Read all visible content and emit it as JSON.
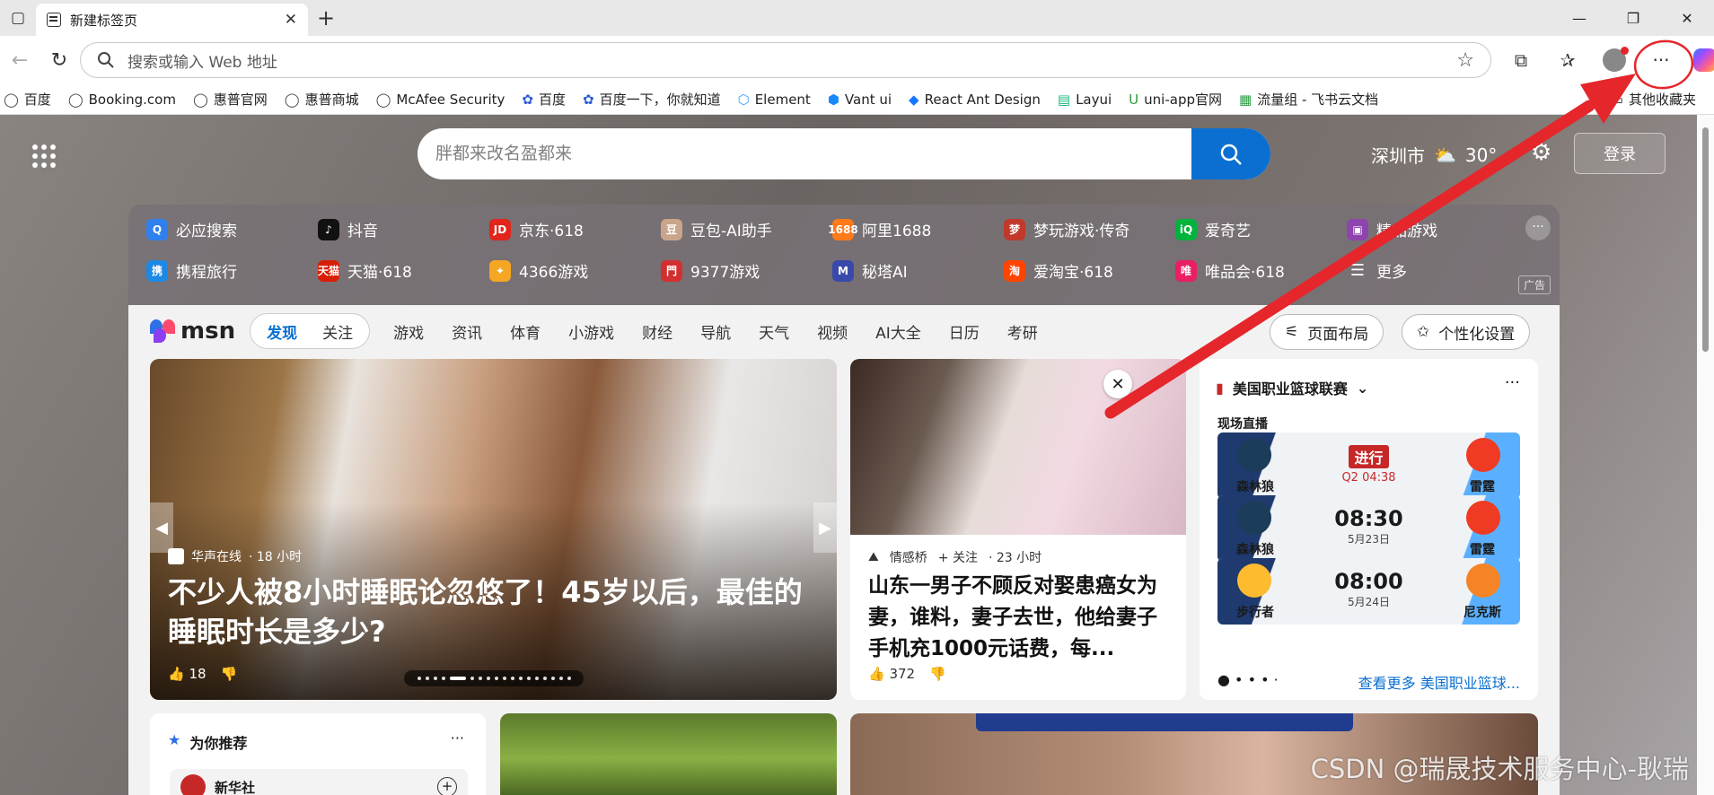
{
  "tab": {
    "title": "新建标签页",
    "close": "✕",
    "new": "+"
  },
  "window": {
    "minimize": "—",
    "restore": "❐",
    "close": "✕"
  },
  "address": {
    "placeholder": "搜索或输入 Web 地址"
  },
  "toolbar": {
    "more": "···"
  },
  "favorites": [
    {
      "label": "百度",
      "icon": "globe"
    },
    {
      "label": "Booking.com",
      "icon": "globe"
    },
    {
      "label": "惠普官网",
      "icon": "globe"
    },
    {
      "label": "惠普商城",
      "icon": "globe"
    },
    {
      "label": "McAfee Security",
      "icon": "globe"
    },
    {
      "label": "百度",
      "icon": "paw"
    },
    {
      "label": "百度一下，你就知道",
      "icon": "paw"
    },
    {
      "label": "Element",
      "icon": "element"
    },
    {
      "label": "Vant ui",
      "icon": "vant"
    },
    {
      "label": "React Ant Design",
      "icon": "ant"
    },
    {
      "label": "Layui",
      "icon": "layui"
    },
    {
      "label": "uni-app官网",
      "icon": "uniapp"
    },
    {
      "label": "流量组 - 飞书云文档",
      "icon": "feishu"
    }
  ],
  "favorites_other": "其他收藏夹",
  "newtab": {
    "search_placeholder": "胖都来改名盈都来",
    "city": "深圳市",
    "temp": "30°",
    "login": "登录"
  },
  "quicklinks": [
    {
      "label": "必应搜索",
      "color": "#2f80ed",
      "glyph": "Q"
    },
    {
      "label": "抖音",
      "color": "#111111",
      "glyph": "♪"
    },
    {
      "label": "京东·618",
      "color": "#e1251b",
      "glyph": "JD"
    },
    {
      "label": "豆包-AI助手",
      "color": "#c9a58b",
      "glyph": "豆"
    },
    {
      "label": "阿里1688",
      "color": "#ff7a1a",
      "glyph": "1688"
    },
    {
      "label": "梦玩游戏·传奇",
      "color": "#c0392b",
      "glyph": "梦"
    },
    {
      "label": "爱奇艺",
      "color": "#00b33c",
      "glyph": "iQ"
    },
    {
      "label": "精品游戏",
      "color": "#8e44ad",
      "glyph": "▣"
    },
    {
      "label": "携程旅行",
      "color": "#1e88e5",
      "glyph": "携"
    },
    {
      "label": "天猫·618",
      "color": "#d81e06",
      "glyph": "天猫"
    },
    {
      "label": "4366游戏",
      "color": "#f5a623",
      "glyph": "✦"
    },
    {
      "label": "9377游戏",
      "color": "#d32f2f",
      "glyph": "門"
    },
    {
      "label": "秘塔AI",
      "color": "#3949ab",
      "glyph": "M"
    },
    {
      "label": "爱淘宝·618",
      "color": "#ff4400",
      "glyph": "淘"
    },
    {
      "label": "唯品会·618",
      "color": "#e91e63",
      "glyph": "唯"
    },
    {
      "label": "更多",
      "color": "transparent",
      "glyph": "☰"
    }
  ],
  "quick_ad": "广告",
  "msn": {
    "logo": "msn",
    "feed_tabs": [
      "发现",
      "关注"
    ],
    "nav": [
      "游戏",
      "资讯",
      "体育",
      "小游戏",
      "财经",
      "导航",
      "天气",
      "视频",
      "AI大全",
      "日历",
      "考研"
    ],
    "layout": "页面布局",
    "personalize": "个性化设置"
  },
  "hero": {
    "source": "华声在线",
    "age": "· 18 小时",
    "title": "不少人被8小时睡眠论忽悠了！45岁以后，最佳的睡眠时长是多少?",
    "likes": "18"
  },
  "card2": {
    "source": "情感桥",
    "follow": "+ 关注",
    "age": "· 23 小时",
    "title": "山东一男子不顾反对娶患癌女为妻，谁料，妻子去世，他给妻子手机充1000元话费，每...",
    "likes": "372"
  },
  "nba": {
    "title": "美国职业篮球联赛",
    "live_label": "现场直播",
    "games": [
      {
        "home": "森林狼",
        "away": "雷霆",
        "status": "进行",
        "clock": "Q2 04:38",
        "live": true
      },
      {
        "home": "森林狼",
        "away": "雷霆",
        "time": "08:30",
        "date": "5月23日",
        "live": false
      },
      {
        "home": "步行者",
        "away": "尼克斯",
        "time": "08:00",
        "date": "5月24日",
        "live": false
      }
    ],
    "more": "查看更多 美国职业篮球..."
  },
  "recommend": {
    "title": "为你推荐",
    "item": "新华社"
  },
  "watermark": "CSDN @瑞晟技术服务中心-耿瑞"
}
